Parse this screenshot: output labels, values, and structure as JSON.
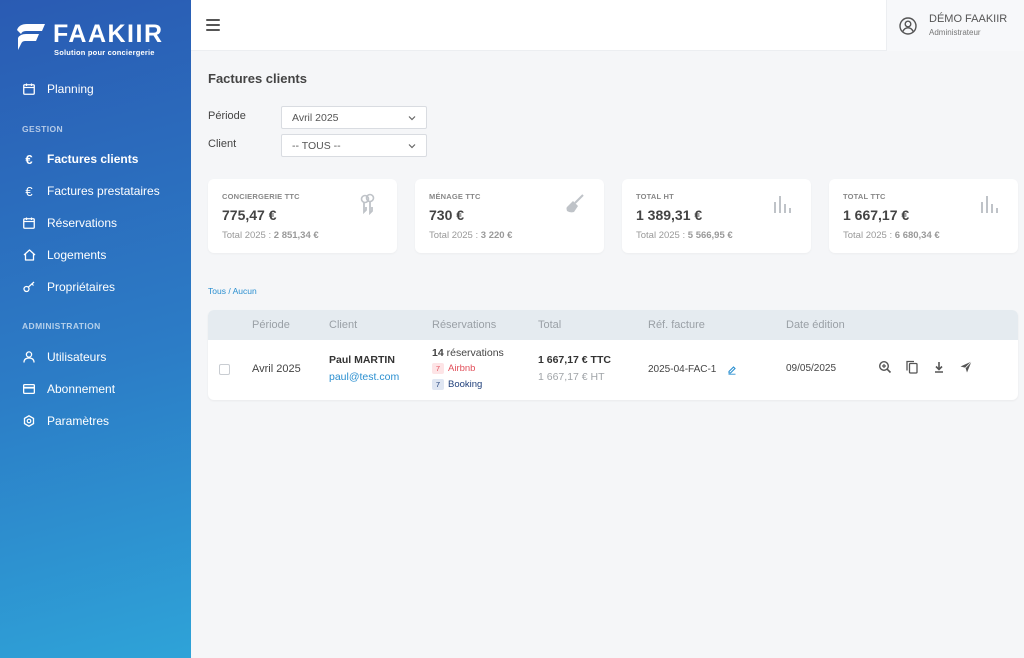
{
  "brand": {
    "name": "FAAKIIR",
    "tagline": "Solution pour conciergerie"
  },
  "sidebar": {
    "items_top": [
      {
        "label": "Planning",
        "icon": "calendar-icon"
      }
    ],
    "section_gestion": "GESTION",
    "items_gestion": [
      {
        "label": "Factures clients",
        "icon": "euro-icon",
        "active": true
      },
      {
        "label": "Factures prestataires",
        "icon": "euro-icon"
      },
      {
        "label": "Réservations",
        "icon": "calendar-icon"
      },
      {
        "label": "Logements",
        "icon": "home-icon"
      },
      {
        "label": "Propriétaires",
        "icon": "key-icon"
      }
    ],
    "section_admin": "ADMINISTRATION",
    "items_admin": [
      {
        "label": "Utilisateurs",
        "icon": "user-icon"
      },
      {
        "label": "Abonnement",
        "icon": "credit-card-icon"
      },
      {
        "label": "Paramètres",
        "icon": "gear-icon"
      }
    ]
  },
  "header": {
    "user_name": "DÉMO FAAKIIR",
    "user_role": "Administrateur"
  },
  "page": {
    "title": "Factures clients"
  },
  "filters": {
    "period_label": "Période",
    "period_value": "Avril 2025",
    "client_label": "Client",
    "client_value": "-- TOUS --"
  },
  "cards": [
    {
      "label": "CONCIERGERIE TTC",
      "value": "775,47 €",
      "sub_label": "Total 2025 :",
      "sub_value": "2 851,34 €",
      "icon": "keys-icon"
    },
    {
      "label": "MÉNAGE TTC",
      "value": "730 €",
      "sub_label": "Total 2025 :",
      "sub_value": "3 220 €",
      "icon": "broom-icon"
    },
    {
      "label": "TOTAL HT",
      "value": "1 389,31 €",
      "sub_label": "Total 2025 :",
      "sub_value": "5 566,95 €",
      "icon": "bar-chart-icon"
    },
    {
      "label": "TOTAL TTC",
      "value": "1 667,17 €",
      "sub_label": "Total 2025 :",
      "sub_value": "6 680,34 €",
      "icon": "bar-chart-icon"
    }
  ],
  "selection": {
    "all": "Tous",
    "separator": "/",
    "none": "Aucun"
  },
  "table": {
    "columns": [
      "Période",
      "Client",
      "Réservations",
      "Total",
      "Réf. facture",
      "Date édition"
    ],
    "rows": [
      {
        "period": "Avril 2025",
        "client_name": "Paul MARTIN",
        "client_email": "paul@test.com",
        "reservations_count": "14",
        "reservations_word": "réservations",
        "channels": [
          {
            "count": "7",
            "name": "Airbnb",
            "color": "#e2505b",
            "bg": "#fde4e6"
          },
          {
            "count": "7",
            "name": "Booking",
            "color": "#1f3f7a",
            "bg": "#dfe6f2"
          }
        ],
        "total_ttc": "1 667,17 € TTC",
        "total_ht": "1 667,17 € HT",
        "ref": "2025-04-FAC-1",
        "date": "09/05/2025"
      }
    ]
  },
  "colors": {
    "accent": "#2a8fd0",
    "sidebar_top": "#2a5bb3",
    "sidebar_bottom": "#2ea3d8"
  }
}
